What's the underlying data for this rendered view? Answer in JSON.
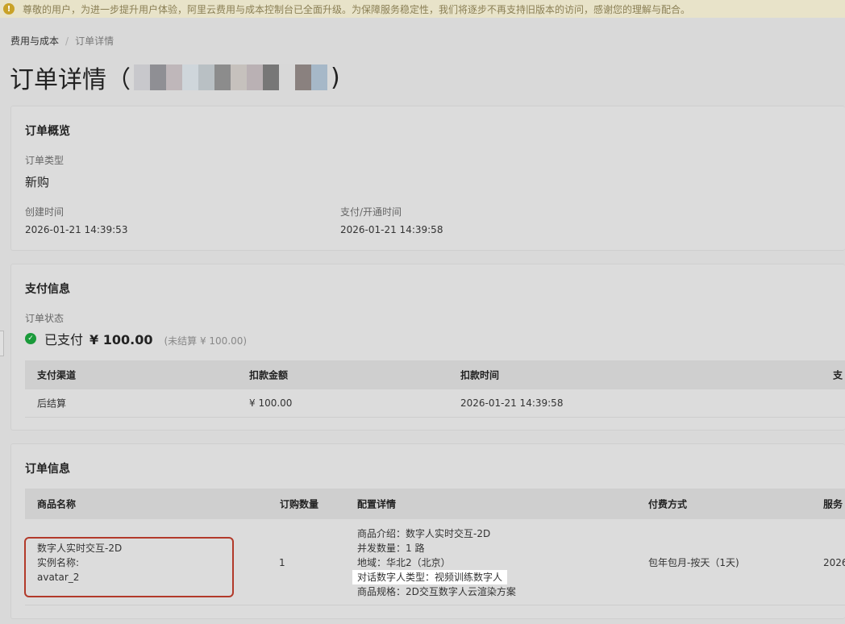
{
  "notice": {
    "text": "尊敬的用户，为进一步提升用户体验，阿里云费用与成本控制台已全面升级。为保障服务稳定性，我们将逐步不再支持旧版本的访问，感谢您的理解与配合。"
  },
  "breadcrumb": {
    "parent": "费用与成本",
    "current": "订单详情"
  },
  "page": {
    "title_prefix": "订单详情（",
    "title_suffix": ")"
  },
  "overview": {
    "title": "订单概览",
    "type_label": "订单类型",
    "type_value": "新购",
    "created_label": "创建时间",
    "created_value": "2026-01-21 14:39:53",
    "paid_label": "支付/开通时间",
    "paid_value": "2026-01-21 14:39:58"
  },
  "payment": {
    "title": "支付信息",
    "status_label": "订单状态",
    "status_text": "已支付",
    "amount": "¥ 100.00",
    "unsettled": "(未结算 ¥ 100.00)",
    "columns": [
      "支付渠道",
      "扣款金额",
      "扣款时间",
      "支"
    ],
    "rows": [
      [
        "后结算",
        "¥ 100.00",
        "2026-01-21 14:39:58"
      ]
    ]
  },
  "order_info": {
    "title": "订单信息",
    "columns": [
      "商品名称",
      "订购数量",
      "配置详情",
      "付费方式",
      "服务"
    ],
    "product_lines": [
      "数字人实时交互-2D",
      "实例名称:",
      "avatar_2"
    ],
    "quantity": "1",
    "config_lines": [
      "商品介绍：数字人实时交互-2D",
      "并发数量：1 路",
      "地域：华北2（北京）",
      "对话数字人类型：视频训练数字人",
      "商品规格：2D交互数字人云渲染方案"
    ],
    "billing": "包年包月-按天（1天)",
    "service_partial": "2026"
  },
  "colors": {
    "highlight_border": "#b23a2a",
    "success": "#1a9a3a"
  }
}
